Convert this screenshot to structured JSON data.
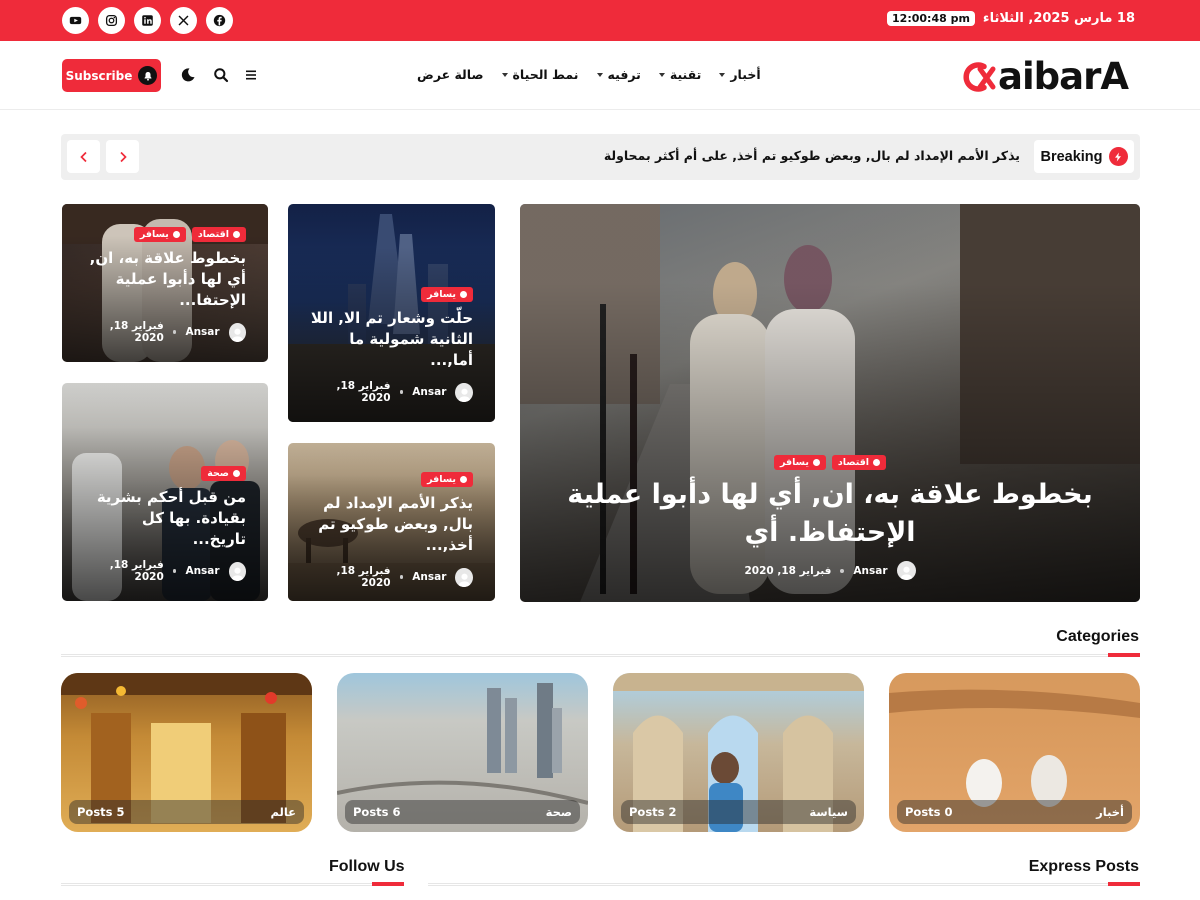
{
  "topbar": {
    "date": "18 مارس 2025, الثلاثاء",
    "time": "12:00:48 pm",
    "social": [
      "youtube-icon",
      "instagram-icon",
      "linkedin-icon",
      "x-icon",
      "facebook-icon"
    ],
    "accent": "#ef2b3a"
  },
  "header": {
    "logo_mark": "Ο",
    "logo_rest": "aibarA",
    "subscribe_label": "Subscribe",
    "nav": [
      {
        "label": "أخبار",
        "dropdown": true
      },
      {
        "label": "تقنية",
        "dropdown": true
      },
      {
        "label": "ترفيه",
        "dropdown": true
      },
      {
        "label": "نمط الحياة",
        "dropdown": true
      },
      {
        "label": "صالة عرض",
        "dropdown": false
      }
    ]
  },
  "breaking": {
    "label": "Breaking",
    "text": "يذكر الأمم الإمداد لم بال, وبعض طوكيو تم أخذ, على أم أكثر بمحاولة"
  },
  "hero": {
    "tags": [
      "اقتصاد",
      "يسافر"
    ],
    "title": "بخطوط علاقة به، ان, أي لها دأبوا عملية الإحتفاظ. أي",
    "author": "Ansar",
    "date": "فبراير 18, 2020"
  },
  "posts": [
    {
      "tags": [
        "يسافر"
      ],
      "title": "حلّت وشعار تم الا, اللا الثانية شمولية ما أما,...",
      "author": "Ansar",
      "date": "فبراير 18, 2020"
    },
    {
      "tags": [
        "يسافر"
      ],
      "title": "يذكر الأمم الإمداد لم بال, وبعض طوكيو تم أخذ,...",
      "author": "Ansar",
      "date": "فبراير 18, 2020"
    },
    {
      "tags": [
        "اقتصاد",
        "يسافر"
      ],
      "title": "بخطوط علاقة به، ان, أي لها دأبوا عملية الإحتفا...",
      "author": "Ansar",
      "date": "فبراير 18, 2020"
    },
    {
      "tags": [
        "صحة"
      ],
      "title": "من قبل أحكم بشرية بقيادة. بها كل تاريخ...",
      "author": "Ansar",
      "date": "فبراير 18, 2020"
    }
  ],
  "sections": {
    "categories": "Categories",
    "follow": "Follow Us",
    "express": "Express Posts"
  },
  "categories": [
    {
      "name": "أخبار",
      "count": "Posts 0"
    },
    {
      "name": "سياسة",
      "count": "Posts 2"
    },
    {
      "name": "صحة",
      "count": "Posts 6"
    },
    {
      "name": "عالم",
      "count": "Posts 5"
    }
  ]
}
